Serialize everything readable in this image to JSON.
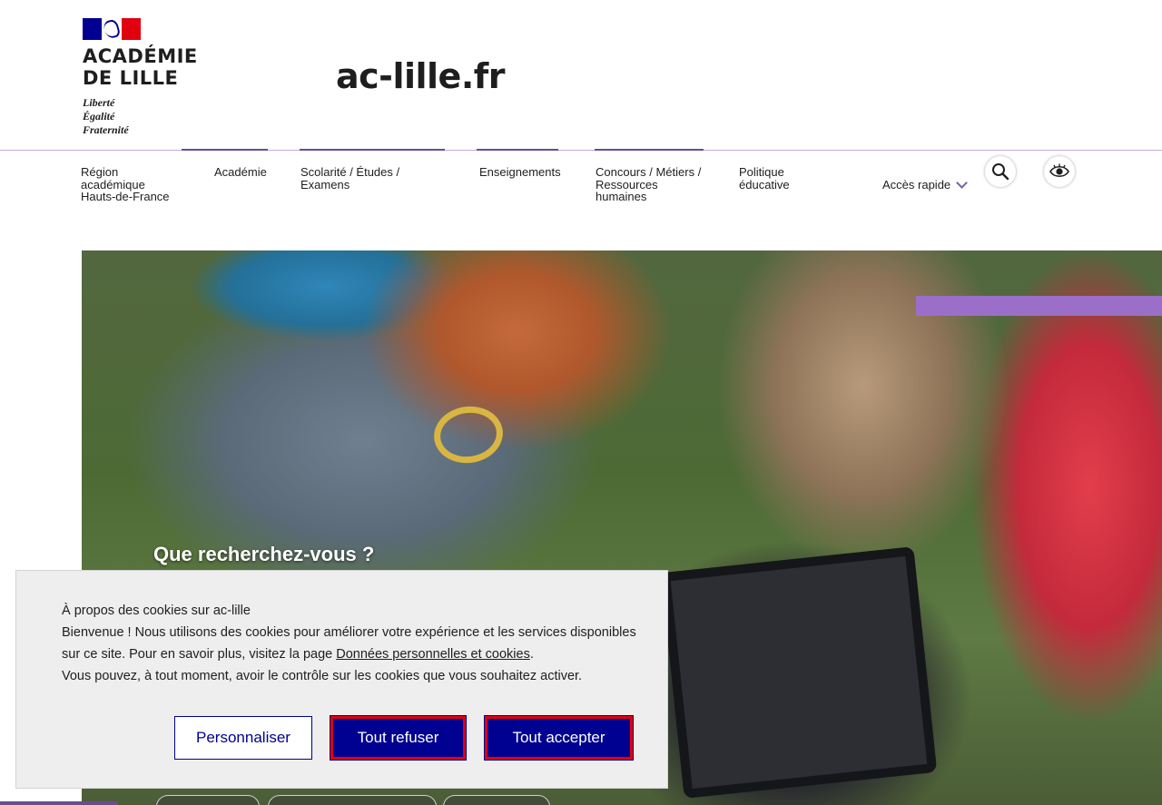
{
  "header": {
    "logo": {
      "name_line1": "ACADÉMIE",
      "name_line2": "DE LILLE",
      "motto": [
        "Liberté",
        "Égalité",
        "Fraternité"
      ]
    },
    "site_title": "ac-lille.fr"
  },
  "nav": {
    "items": [
      {
        "label": "Région académique Hauts-de-France"
      },
      {
        "label": "Académie"
      },
      {
        "label": "Scolarité / Études / Examens"
      },
      {
        "label": "Enseignements"
      },
      {
        "label": "Concours / Métiers / Ressources humaines"
      },
      {
        "label": "Politique éducative"
      }
    ],
    "quick_access": "Accès rapide",
    "search_icon": "search-icon",
    "accessibility_icon": "eye-icon"
  },
  "hero": {
    "search_heading": "Que recherchez-vous ?"
  },
  "cookie_banner": {
    "title": "À propos des cookies sur ac-lille",
    "text_before_link": "Bienvenue ! Nous utilisons des cookies pour améliorer votre expérience et les services disponibles sur ce site. Pour en savoir plus, visitez la page ",
    "link_label": "Données personnelles et cookies",
    "text_after_link": ".",
    "text_line_last": "Vous pouvez, à tout moment, avoir le contrôle sur les cookies que vous souhaitez activer.",
    "buttons": {
      "customize": "Personnaliser",
      "refuse_all": "Tout refuser",
      "accept_all": "Tout accepter"
    }
  },
  "colors": {
    "brand_blue": "#000091",
    "brand_red": "#e1000f",
    "accent_purple": "#9b6fc9"
  }
}
